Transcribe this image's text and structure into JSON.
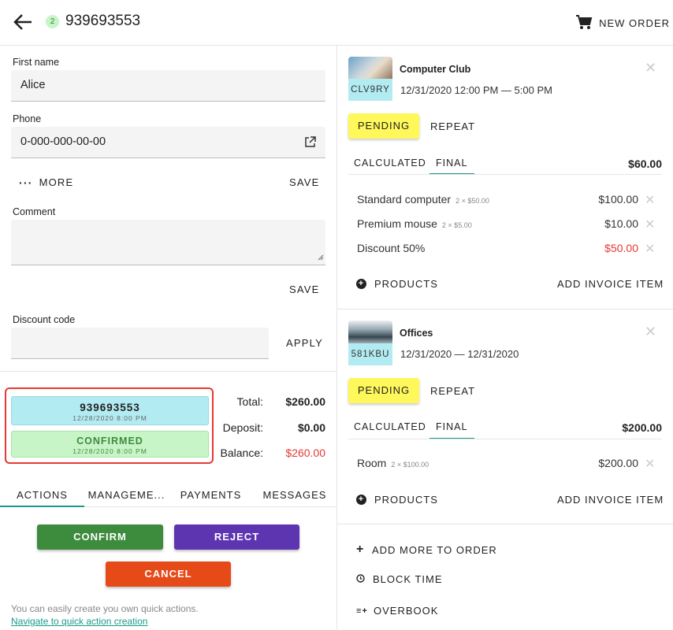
{
  "header": {
    "order_count": "2",
    "order_id": "939693553",
    "new_order_label": "NEW ORDER"
  },
  "customer": {
    "first_name_label": "First name",
    "first_name_value": "Alice",
    "phone_label": "Phone",
    "phone_value": "0-000-000-00-00",
    "more_label": "MORE",
    "save_label": "SAVE",
    "comment_label": "Comment",
    "comment_value": "",
    "comment_save_label": "SAVE",
    "discount_label": "Discount code",
    "discount_value": "",
    "apply_label": "APPLY"
  },
  "status": {
    "order_chip_title": "939693553",
    "order_chip_date": "12/28/2020 8:00 PM",
    "confirmed_chip_title": "CONFIRMED",
    "confirmed_chip_date": "12/28/2020 8:00 PM"
  },
  "summary": {
    "total_label": "Total:",
    "total_value": "$260.00",
    "deposit_label": "Deposit:",
    "deposit_value": "$0.00",
    "balance_label": "Balance:",
    "balance_value": "$260.00"
  },
  "tabs": [
    "ACTIONS",
    "MANAGEME...",
    "PAYMENTS",
    "MESSAGES"
  ],
  "actions": {
    "confirm": "CONFIRM",
    "reject": "REJECT",
    "cancel": "CANCEL",
    "hint": "You can easily create you own quick actions.",
    "link": "Navigate to quick action creation"
  },
  "reservations": [
    {
      "name": "Computer Club",
      "code": "CLV9RY",
      "time": "12/31/2020 12:00 PM — 5:00 PM",
      "status": "PENDING",
      "repeat": "REPEAT",
      "tab_calculated": "CALCULATED",
      "tab_final": "FINAL",
      "total": "$60.00",
      "items": [
        {
          "name": "Standard computer",
          "qty": "2 × $50.00",
          "price": "$100.00"
        },
        {
          "name": "Premium mouse",
          "qty": "2 × $5.00",
          "price": "$10.00"
        },
        {
          "name": "Discount 50%",
          "qty": "",
          "price": "$50.00"
        }
      ],
      "products_label": "PRODUCTS",
      "add_invoice_label": "ADD INVOICE ITEM"
    },
    {
      "name": "Offices",
      "code": "581KBU",
      "time": "12/31/2020 — 12/31/2020",
      "status": "PENDING",
      "repeat": "REPEAT",
      "tab_calculated": "CALCULATED",
      "tab_final": "FINAL",
      "total": "$200.00",
      "items": [
        {
          "name": "Room",
          "qty": "2 × $100.00",
          "price": "$200.00"
        }
      ],
      "products_label": "PRODUCTS",
      "add_invoice_label": "ADD INVOICE ITEM"
    }
  ],
  "order_actions": {
    "add_more": "ADD MORE TO ORDER",
    "block_time": "BLOCK TIME",
    "overbook": "OVERBOOK"
  },
  "colors": {
    "chip_order_bg": "#b3ebf2",
    "chip_confirmed_bg": "#c8f5c8",
    "confirm_btn": "#3d8b3d",
    "reject_btn": "#5e35b1",
    "cancel_btn": "#e64a19",
    "pending_bg": "#fef85a",
    "balance_red": "#e53935",
    "tab_underline": "#1a9a8a"
  }
}
